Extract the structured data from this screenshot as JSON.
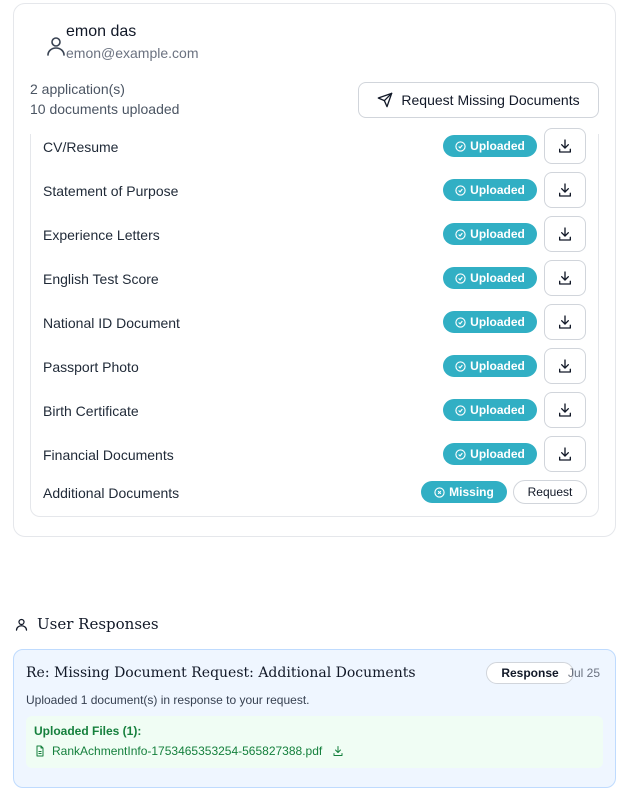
{
  "user": {
    "name": "emon das",
    "email": "emon@example.com",
    "applications": "2 application(s)",
    "documents_uploaded": "10 documents uploaded"
  },
  "actions": {
    "request_missing_label": "Request Missing Documents"
  },
  "documents": [
    {
      "name": "CV/Resume",
      "status": "Uploaded"
    },
    {
      "name": "Statement of Purpose",
      "status": "Uploaded"
    },
    {
      "name": "Experience Letters",
      "status": "Uploaded"
    },
    {
      "name": "English Test Score",
      "status": "Uploaded"
    },
    {
      "name": "National ID Document",
      "status": "Uploaded"
    },
    {
      "name": "Passport Photo",
      "status": "Uploaded"
    },
    {
      "name": "Birth Certificate",
      "status": "Uploaded"
    },
    {
      "name": "Financial Documents",
      "status": "Uploaded"
    },
    {
      "name": "Additional Documents",
      "status": "Missing",
      "action": "Request"
    }
  ],
  "responses": {
    "heading": "User Responses",
    "items": [
      {
        "title": "Re: Missing Document Request: Additional Documents",
        "badge": "Response",
        "date": "Jul 25",
        "message": "Uploaded 1 document(s) in response to your request.",
        "files_title": "Uploaded Files (1):",
        "file_name": "RankAchmentInfo-1753465353254-565827388.pdf"
      }
    ]
  },
  "colors": {
    "accent": "#31afc4",
    "green_text": "#15803d",
    "blue_bg": "#eff6ff"
  }
}
